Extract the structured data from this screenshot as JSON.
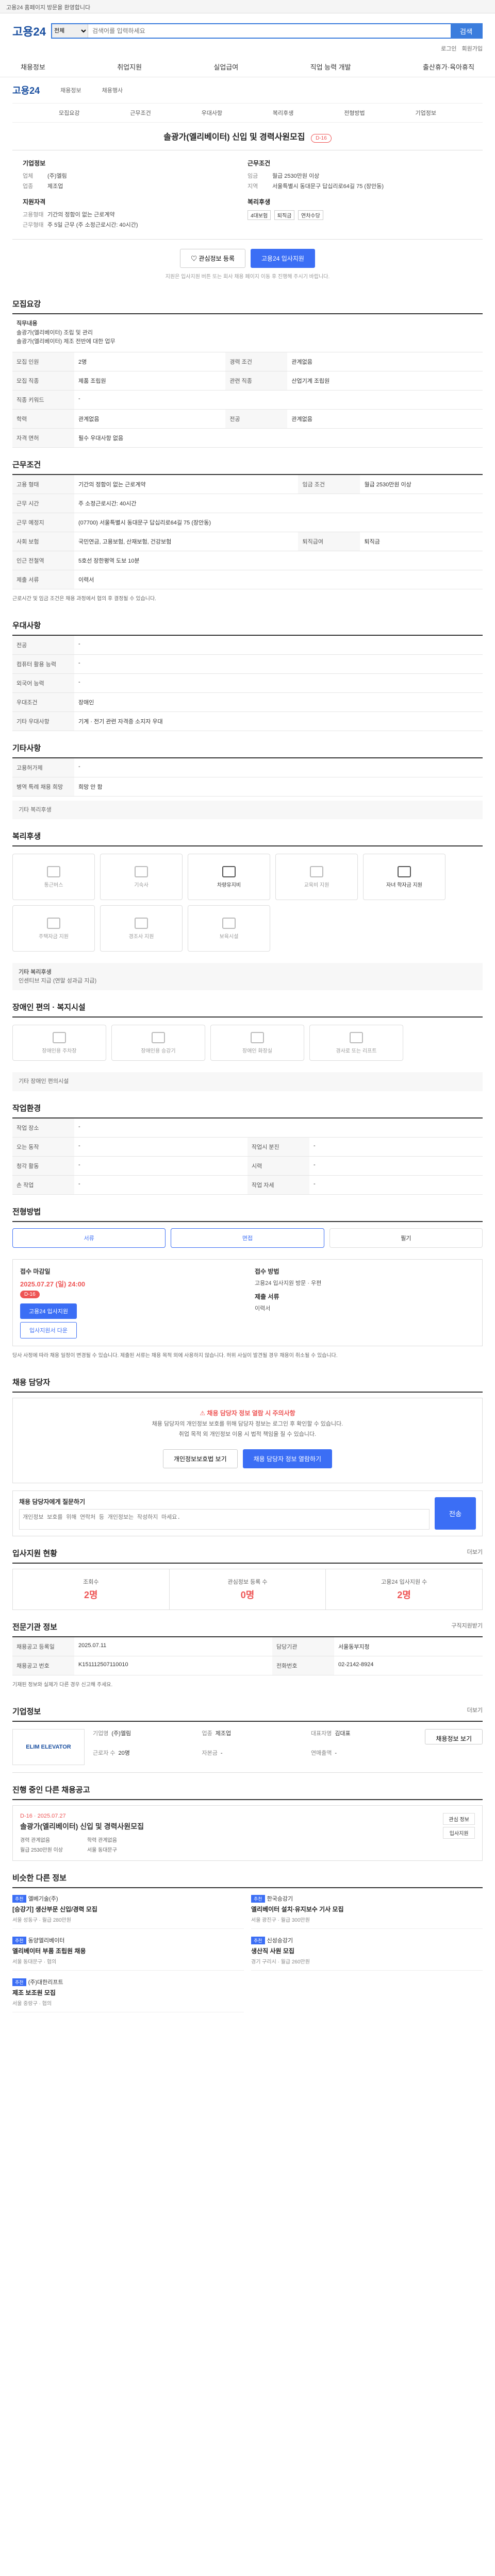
{
  "topbar": {
    "text": "고용24 홈페이지 방문을 환영합니다"
  },
  "header": {
    "logo": "고용24",
    "search_option": "전체",
    "search_placeholder": "검색어를 입력하세요",
    "search_button": "검색",
    "utils": [
      "로그인",
      "회원가입"
    ]
  },
  "nav": [
    "채용정보",
    "취업지원",
    "실업급여",
    "직업 능력 개발",
    "출산휴가·육아휴직"
  ],
  "subheader": {
    "logo": "고용24",
    "links": [
      "채용정보",
      "채용행사"
    ]
  },
  "subtabs": [
    "모집요강",
    "근무조건",
    "우대사항",
    "복리후생",
    "전형방법",
    "기업정보"
  ],
  "job": {
    "title": "솔광가(엘리베이터) 신입 및 경력사원모집",
    "dday": "D-16",
    "company_heading": "기업정보",
    "company": [
      {
        "k": "업체",
        "v": "(주)엘림"
      },
      {
        "k": "업종",
        "v": "제조업"
      }
    ],
    "cond_heading": "근무조건",
    "cond": [
      {
        "k": "임금",
        "v": "월급 2530만원 이상"
      },
      {
        "k": "지역",
        "v": "서울특별시 동대문구 답십리로64길 75 (장안동)"
      }
    ],
    "qual_heading": "지원자격",
    "qual": [
      {
        "k": "고용형태",
        "v": "기간의 정함이 없는 근로계약"
      },
      {
        "k": "근무형태",
        "v": "주 5일 근무 (주 소정근로시간: 40시간)"
      }
    ],
    "welfare_heading": "복리후생",
    "welfare_tags": [
      "4대보험",
      "퇴직금",
      "연차수당"
    ],
    "btn_scrap": "관심정보 등록",
    "btn_apply": "고용24 입사지원",
    "note": "지원은 입사지원 버튼 또는 회사 채용 페이지 이동 후 진행해 주시기 바랍니다."
  },
  "sections": {
    "recruit": {
      "title": "모집요강",
      "duty_label": "직무내용",
      "duty_text": "솔광가(엘리베이터) 조립 및 관리",
      "duty_detail": "솔광가(엘리베이터) 제조 전반에 대한 업무",
      "rows": [
        {
          "k": "모집 인원",
          "v": "2명",
          "k2": "경력 조건",
          "v2": "관계없음"
        },
        {
          "k": "모집 직종",
          "v": "제품 조립원",
          "k2": "관련 직종",
          "v2": "산업기계 조립원"
        },
        {
          "k": "직종 키워드",
          "v": "-",
          "k2": "",
          "v2": ""
        },
        {
          "k": "학력",
          "v": "관계없음",
          "k2": "전공",
          "v2": "관계없음"
        },
        {
          "k": "자격 면허",
          "v": "필수 우대사항 없음",
          "k2": "",
          "v2": ""
        }
      ]
    },
    "work": {
      "title": "근무조건",
      "rows": [
        {
          "k": "고용 형태",
          "v": "기간의 정함이 없는 근로계약",
          "k2": "임금 조건",
          "v2": "월급 2530만원 이상"
        },
        {
          "k": "근무 시간",
          "v": "주 소정근로시간: 40시간",
          "k2": "",
          "v2": ""
        },
        {
          "k": "근무 예정지",
          "v": "(07700) 서울특별시 동대문구 답십리로64길 75 (장안동)",
          "k2": "",
          "v2": ""
        },
        {
          "k": "사회 보험",
          "v": "국민연금, 고용보험, 산재보험, 건강보험",
          "k2": "퇴직급여",
          "v2": "퇴직금"
        },
        {
          "k": "인근 전철역",
          "v": "5호선 장한평역 도보 10분",
          "k2": "",
          "v2": ""
        },
        {
          "k": "제출 서류",
          "v": "이력서",
          "k2": "",
          "v2": ""
        }
      ],
      "note": "근로시간 및 임금 조건은 채용 과정에서 협의 후 결정될 수 있습니다."
    },
    "prefer": {
      "title": "우대사항",
      "rows": [
        {
          "k": "전공",
          "v": "-"
        },
        {
          "k": "컴퓨터 활용 능력",
          "v": "-"
        },
        {
          "k": "외국어 능력",
          "v": "-"
        },
        {
          "k": "우대조건",
          "v": "장애인"
        },
        {
          "k": "기타 우대사항",
          "v": "기계 · 전기 관련 자격증 소지자 우대"
        }
      ]
    },
    "etc": {
      "title": "기타사항",
      "rows": [
        {
          "k": "고용허가제",
          "v": "-"
        },
        {
          "k": "병역 특례 채용 희망",
          "v": "희망 안 함"
        }
      ],
      "more_label": "기타 복리후생"
    },
    "welfare": {
      "title": "복리후생",
      "items": [
        {
          "name": "통근버스",
          "on": false
        },
        {
          "name": "기숙사",
          "on": false
        },
        {
          "name": "차량유지비",
          "on": true
        },
        {
          "name": "교육비 지원",
          "on": false
        },
        {
          "name": "자녀 학자금 지원",
          "on": true
        },
        {
          "name": "주택자금 지원",
          "on": false
        },
        {
          "name": "경조사 지원",
          "on": false
        },
        {
          "name": "보육시설",
          "on": false
        }
      ],
      "extra_label": "기타 복리후생",
      "extra_text": "인센티브 지급 (연말 성과급 지급)"
    },
    "disabled": {
      "title": "장애인 편의 · 복지시설",
      "items": [
        "장애인용 주차장",
        "장애인용 승강기",
        "장애인 화장실",
        "경사로 또는 리프트"
      ],
      "extra_label": "기타 장애인 편의시설"
    },
    "env": {
      "title": "작업환경",
      "rows": [
        {
          "k": "작업 장소",
          "v": "-",
          "k2": "",
          "v2": ""
        },
        {
          "k": "오는 동작",
          "v": "-",
          "k2": "작업시 분진",
          "v2": "-"
        },
        {
          "k": "청각 활동",
          "v": "-",
          "k2": "시력",
          "v2": "-"
        },
        {
          "k": "손 작업",
          "v": "-",
          "k2": "작업 자세",
          "v2": "-"
        }
      ]
    },
    "process": {
      "title": "전형방법",
      "methods": [
        {
          "name": "서류",
          "on": true
        },
        {
          "name": "면접",
          "on": true
        },
        {
          "name": "필기",
          "on": false
        }
      ],
      "period_label": "접수 마감일",
      "period": "2025.07.27 (일) 24:00",
      "dday": "D-16",
      "apply_btn": "고용24 입사지원",
      "print_btn": "입사지원서 다운",
      "method_label": "접수 방법",
      "method_text": "고용24 입사지원 방문 · 우편",
      "docs_label": "제출 서류",
      "docs_text": "이력서",
      "notes": "당사 사정에 따라 채용 일정이 변경될 수 있습니다. 제출된 서류는 채용 목적 외에 사용하지 않습니다. 허위 사실이 발견될 경우 채용이 취소될 수 있습니다."
    },
    "contact": {
      "title": "채용 담당자",
      "head": "채용 담당자 정보 열람 시 주의사항",
      "p1": "채용 담당자의 개인정보 보호를 위해 담당자 정보는 로그인 후 확인할 수 있습니다.",
      "p2": "취업 목적 외 개인정보 이용 시 법적 책임을 질 수 있습니다.",
      "btn1": "개인정보보호법 보기",
      "btn2": "채용 담당자 정보 열람하기",
      "q_label": "채용 담당자에게 질문하기",
      "q_placeholder": "개인정보 보호를 위해 연락처 등 개인정보는 작성하지 마세요.",
      "q_btn": "전송"
    },
    "stats": {
      "title": "입사지원 현황",
      "more": "더보기",
      "items": [
        {
          "k": "조회수",
          "v": "2명"
        },
        {
          "k": "관심정보 등록 수",
          "v": "0명"
        },
        {
          "k": "고용24 입사지원 수",
          "v": "2명"
        }
      ]
    },
    "agency": {
      "title": "전문기관 정보",
      "more": "구직지원받기",
      "rows": [
        {
          "k": "채용공고 등록일",
          "v": "2025.07.11",
          "k2": "담당기관",
          "v2": "서울동부지청"
        },
        {
          "k": "채용공고 번호",
          "v": "K151112507110010",
          "k2": "전화번호",
          "v2": "02-2142-8924"
        }
      ],
      "note": "기재된 정보와 실제가 다른 경우 신고해 주세요."
    },
    "company": {
      "title": "기업정보",
      "more": "더보기",
      "logo": "ELIM ELEVATOR",
      "info": [
        {
          "k": "기업명",
          "v": "(주)엘림"
        },
        {
          "k": "업종",
          "v": "제조업"
        },
        {
          "k": "대표자명",
          "v": "김대표"
        },
        {
          "k": "근로자 수",
          "v": "20명"
        },
        {
          "k": "자본금",
          "v": "-"
        },
        {
          "k": "연매출액",
          "v": "-"
        }
      ],
      "btn": "채용정보 보기"
    },
    "recruit_other": {
      "title": "진행 중인 다른 채용공고",
      "dday": "D-16 · 2025.07.27",
      "job_title": "솔광가(엘리베이터) 신입 및 경력사원모집",
      "meta": [
        "경력 관계없음",
        "학력 관계없음",
        "월급 2530만원 이상",
        "서울 동대문구"
      ],
      "side": [
        "관심 정보",
        "입사지원"
      ]
    },
    "others": {
      "title": "비슷한 다른 정보",
      "items": [
        {
          "badge": "추천",
          "company": "엘베기술(주)",
          "title": "[승강기] 생산부문 신입/경력 모집",
          "meta": "서울 성동구 · 월급 280만원"
        },
        {
          "badge": "추천",
          "company": "한국승강기",
          "title": "엘리베이터 설치·유지보수 기사 모집",
          "meta": "서울 광진구 · 월급 300만원"
        },
        {
          "badge": "추천",
          "company": "동양엘리베이터",
          "title": "엘리베이터 부품 조립원 채용",
          "meta": "서울 동대문구 · 협의"
        },
        {
          "badge": "추천",
          "company": "신성승강기",
          "title": "생산직 사원 모집",
          "meta": "경기 구리시 · 월급 260만원"
        },
        {
          "badge": "추천",
          "company": "(주)대한리프트",
          "title": "제조 보조원 모집",
          "meta": "서울 중랑구 · 협의"
        }
      ]
    }
  }
}
